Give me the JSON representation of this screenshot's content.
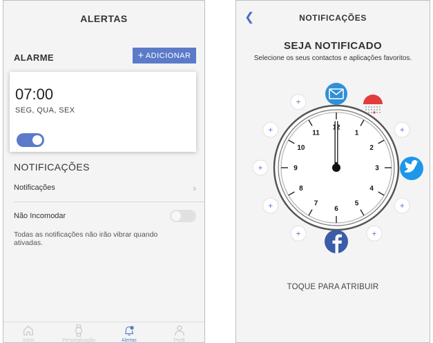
{
  "left": {
    "title": "ALERTAS",
    "alarm_section_label": "ALARME",
    "add_button_label": "ADICIONAR",
    "alarm": {
      "time": "07:00",
      "days": "SEG, QUA, SEX",
      "enabled": true
    },
    "notifications_heading": "NOTIFICAÇÕES",
    "notifications_row_label": "Notificações",
    "dnd_label": "Não Incomodar",
    "dnd_enabled": false,
    "dnd_description": "Todas as notificações não irão vibrar quando ativadas.",
    "tabs": [
      {
        "label": "Início",
        "icon": "home-icon",
        "active": false
      },
      {
        "label": "Personalização",
        "icon": "watch-icon",
        "active": false
      },
      {
        "label": "Alertas",
        "icon": "bell-gear-icon",
        "active": true
      },
      {
        "label": "Perfil",
        "icon": "person-icon",
        "active": false
      }
    ]
  },
  "right": {
    "title": "NOTIFICAÇÕES",
    "heading": "SEJA NOTIFICADO",
    "subtitle": "Selecione os seus contactos e aplicações favoritos.",
    "clock_numbers": [
      "12",
      "1",
      "2",
      "3",
      "4",
      "5",
      "6",
      "7",
      "8",
      "9",
      "10",
      "11"
    ],
    "clock_time": "12:00",
    "assigned_apps": [
      {
        "hour": 12,
        "icon": "mail-icon",
        "color": "#2f8fd8"
      },
      {
        "hour": 1,
        "icon": "calendar-icon",
        "color": "#e23c3c"
      },
      {
        "hour": 3,
        "icon": "twitter-icon",
        "color": "#1f97e8"
      },
      {
        "hour": 6,
        "icon": "facebook-icon",
        "color": "#3b5ca8"
      }
    ],
    "empty_slot_label": "+",
    "tap_hint": "TOQUE PARA ATRIBUIR"
  },
  "colors": {
    "accent": "#5b7bc9",
    "background": "#f4f4f4"
  }
}
